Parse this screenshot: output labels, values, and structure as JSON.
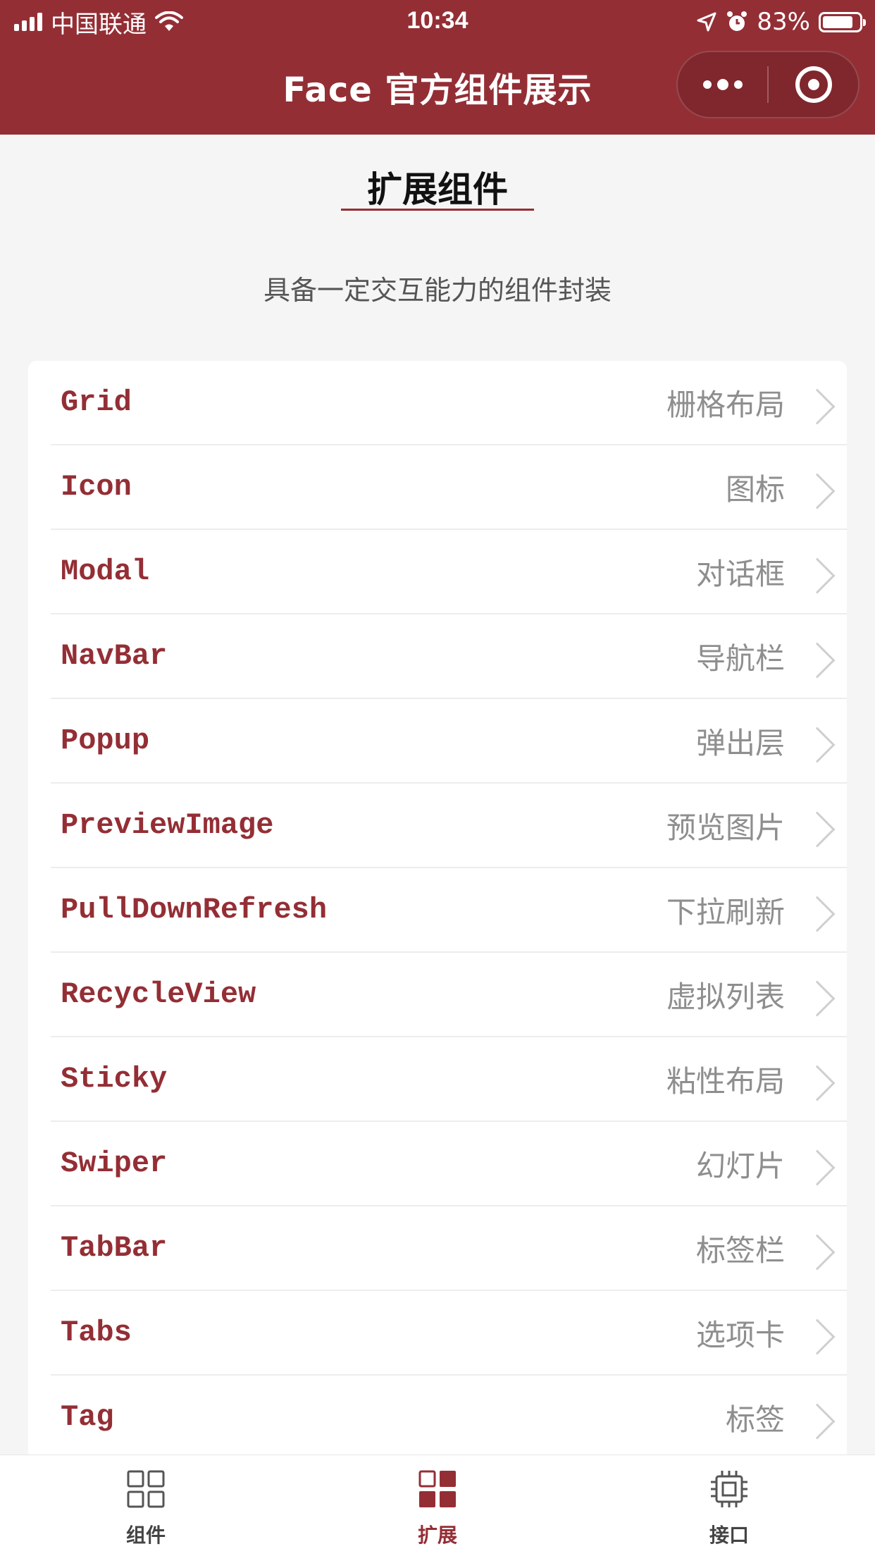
{
  "status_bar": {
    "carrier": "中国联通",
    "time": "10:34",
    "battery": "83%",
    "battery_level": 0.83
  },
  "nav": {
    "title": "Face 官方组件展示",
    "more_icon": "more-dots-icon",
    "close_icon": "target-icon"
  },
  "header": {
    "title": "扩展组件",
    "description": "具备一定交互能力的组件封装"
  },
  "list": {
    "items": [
      {
        "name": "Grid",
        "desc": "栅格布局"
      },
      {
        "name": "Icon",
        "desc": "图标"
      },
      {
        "name": "Modal",
        "desc": "对话框"
      },
      {
        "name": "NavBar",
        "desc": "导航栏"
      },
      {
        "name": "Popup",
        "desc": "弹出层"
      },
      {
        "name": "PreviewImage",
        "desc": "预览图片"
      },
      {
        "name": "PullDownRefresh",
        "desc": "下拉刷新"
      },
      {
        "name": "RecycleView",
        "desc": "虚拟列表"
      },
      {
        "name": "Sticky",
        "desc": "粘性布局"
      },
      {
        "name": "Swiper",
        "desc": "幻灯片"
      },
      {
        "name": "TabBar",
        "desc": "标签栏"
      },
      {
        "name": "Tabs",
        "desc": "选项卡"
      },
      {
        "name": "Tag",
        "desc": "标签"
      }
    ]
  },
  "tabbar": {
    "items": [
      {
        "label": "组件",
        "icon": "grid-outline-icon",
        "active": false
      },
      {
        "label": "扩展",
        "icon": "grid-filled-icon",
        "active": true
      },
      {
        "label": "接口",
        "icon": "chip-icon",
        "active": false
      }
    ]
  },
  "colors": {
    "brand": "#942e35",
    "background": "#f4f5f4",
    "muted_text": "#8e8e8e"
  }
}
